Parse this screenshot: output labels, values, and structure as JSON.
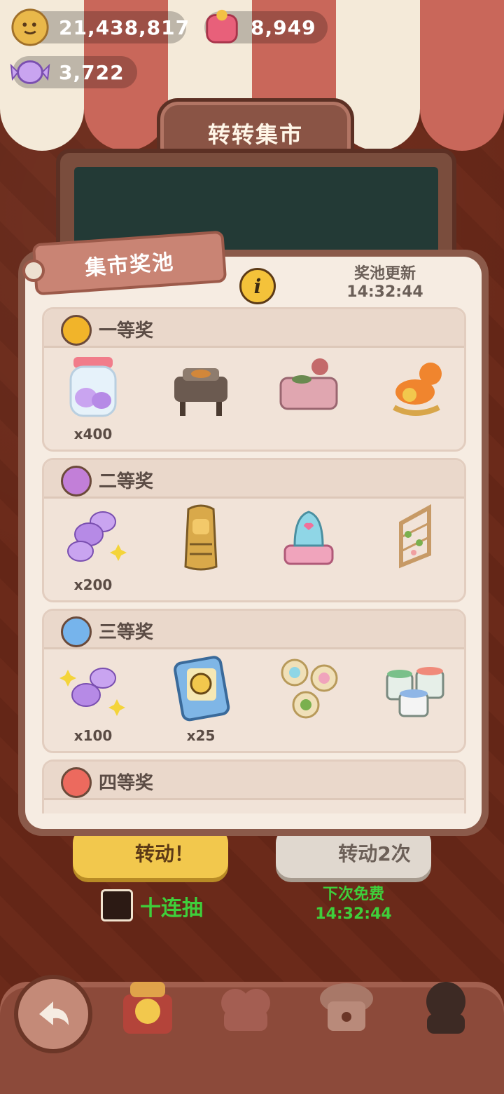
{
  "currencies": [
    {
      "name": "cookie-coin",
      "value": "21,438,817"
    },
    {
      "name": "ruby-gem",
      "value": "8,949"
    },
    {
      "name": "candy",
      "value": "3,722"
    }
  ],
  "title": "转转集市",
  "dialog": {
    "tag_label": "集市奖池",
    "refresh_label": "奖池更新",
    "refresh_time": "14:32:44",
    "tiers": [
      {
        "name": "一等奖",
        "color": "#f1b42a",
        "items": [
          {
            "icon": "candy-jar-icon",
            "qty": "x400"
          },
          {
            "icon": "bbq-grill-icon",
            "qty": ""
          },
          {
            "icon": "tea-counter-icon",
            "qty": ""
          },
          {
            "icon": "rocking-horse-icon",
            "qty": ""
          }
        ]
      },
      {
        "name": "二等奖",
        "color": "#c27fd8",
        "items": [
          {
            "icon": "candy-pile-icon",
            "qty": "x200"
          },
          {
            "icon": "pharaoh-sarcophagus-icon",
            "qty": ""
          },
          {
            "icon": "music-box-icon",
            "qty": ""
          },
          {
            "icon": "vine-trellis-icon",
            "qty": ""
          }
        ]
      },
      {
        "name": "三等奖",
        "color": "#76b4ec",
        "items": [
          {
            "icon": "candy-pair-icon",
            "qty": "x100"
          },
          {
            "icon": "fist-card-icon",
            "qty": "x25"
          },
          {
            "icon": "badge-set-icon",
            "qty": ""
          },
          {
            "icon": "paint-buckets-icon",
            "qty": ""
          }
        ]
      },
      {
        "name": "四等奖",
        "color": "#ec6a5e",
        "items": []
      }
    ]
  },
  "buttons": {
    "spin": "转动！",
    "spin_twice": "转动2次",
    "ten_draw": "十连抽",
    "free_label": "下次免费",
    "free_time": "14:32:44"
  }
}
